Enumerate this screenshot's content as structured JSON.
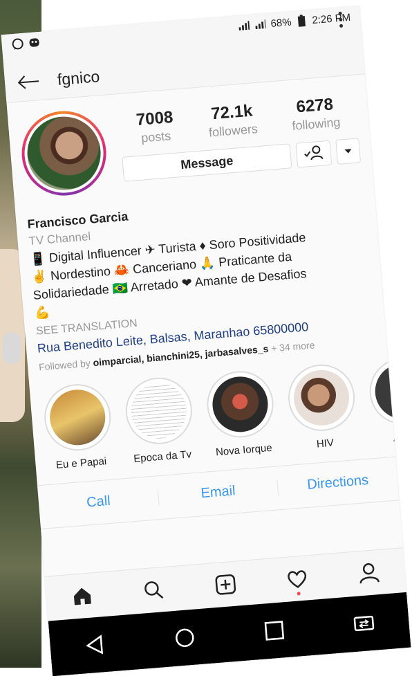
{
  "status_bar": {
    "battery": "68%",
    "time": "2:26 PM",
    "left_icons": [
      "whatsapp-icon",
      "notification-icon"
    ]
  },
  "header": {
    "username": "fgnico"
  },
  "stats": [
    {
      "value": "7008",
      "label": "posts"
    },
    {
      "value": "72.1k",
      "label": "followers"
    },
    {
      "value": "6278",
      "label": "following"
    }
  ],
  "actions": {
    "message_label": "Message"
  },
  "bio": {
    "name": "Francisco Garcia",
    "category": "TV Channel",
    "line1": "📱 Digital Influencer ✈ Turista ♦ Soro Positividade",
    "line2": "✌ Nordestino 🦀 Canceriano 🙏 Praticante da",
    "line3": "Solidariedade 🇧🇷 Arretado ❤ Amante de Desafios",
    "line4": "💪",
    "see_translation": "SEE TRANSLATION",
    "address": "Rua Benedito Leite, Balsas, Maranhao 65800000",
    "followed_by_prefix": "Followed by",
    "followed_by_names": "oimparcial, bianchini25, jarbasalves_s",
    "followed_by_more": "+ 34 more"
  },
  "highlights": [
    {
      "label": "Eu e Papai"
    },
    {
      "label": "Epoca da Tv"
    },
    {
      "label": "Nova Iorque"
    },
    {
      "label": "HIV"
    },
    {
      "label": "Aldair"
    }
  ],
  "contact": {
    "call": "Call",
    "email": "Email",
    "directions": "Directions"
  },
  "colors": {
    "link_blue": "#3897f0",
    "address_blue": "#1f3f86",
    "muted_gray": "#999999",
    "notification_red": "#ed4956"
  }
}
